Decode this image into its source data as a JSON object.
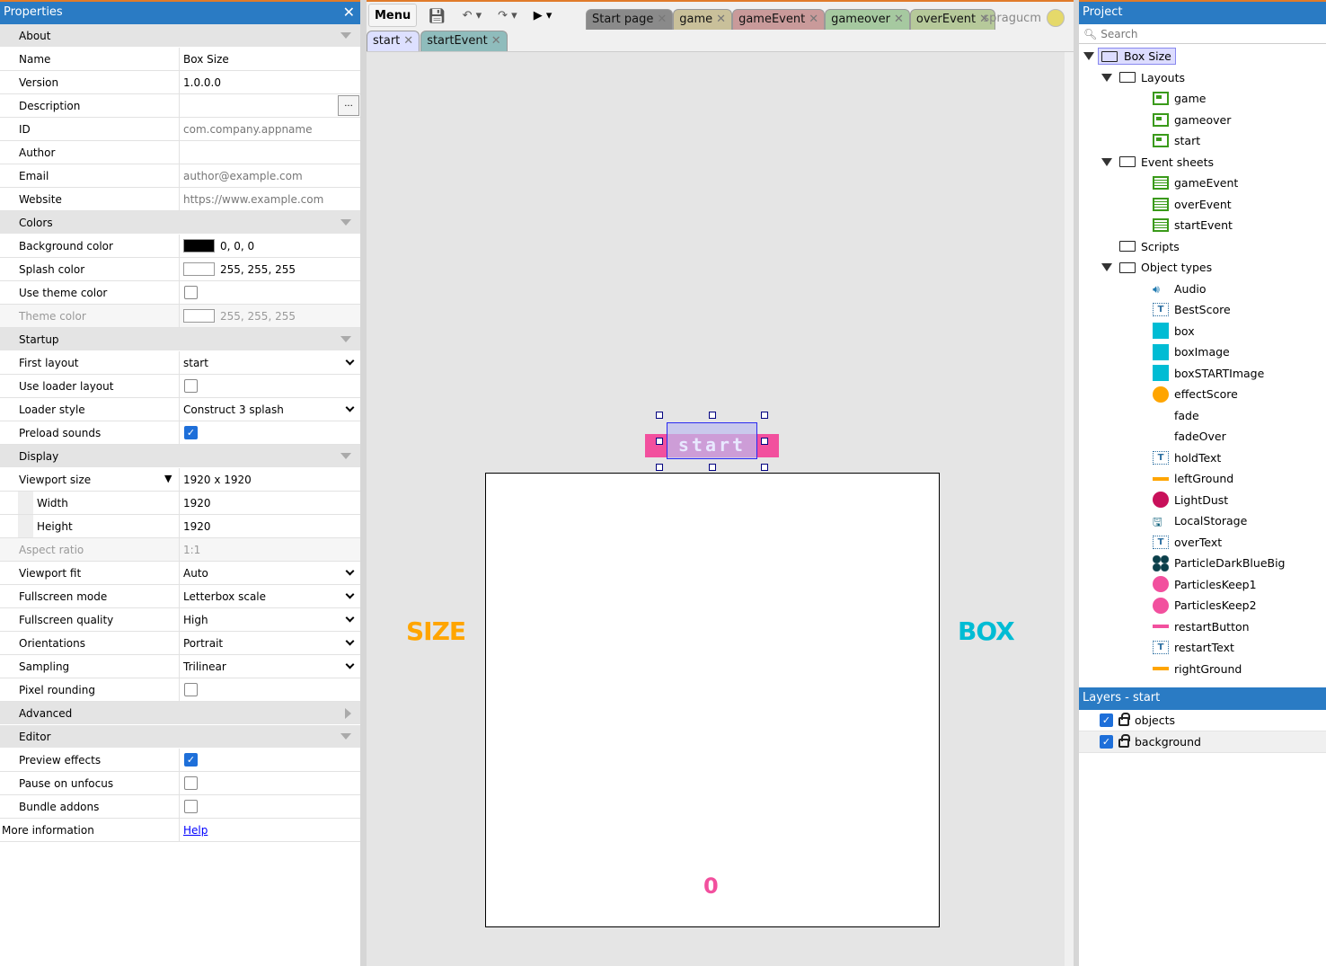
{
  "properties": {
    "title": "Properties",
    "rows": [
      {
        "t": "sec",
        "label": "About"
      },
      {
        "label": "Name",
        "value": "Box Size"
      },
      {
        "label": "Version",
        "value": "1.0.0.0"
      },
      {
        "label": "Description",
        "value": "",
        "button": "..."
      },
      {
        "label": "ID",
        "value": "com.company.appname",
        "grey": true
      },
      {
        "label": "Author",
        "value": ""
      },
      {
        "label": "Email",
        "value": "author@example.com",
        "grey": true
      },
      {
        "label": "Website",
        "value": "https://www.example.com",
        "grey": true
      },
      {
        "t": "sec",
        "label": "Colors"
      },
      {
        "label": "Background color",
        "value": "0, 0, 0",
        "swatch": "#000000"
      },
      {
        "label": "Splash color",
        "value": "255, 255, 255",
        "swatch": "#ffffff"
      },
      {
        "label": "Use theme color",
        "check": false
      },
      {
        "label": "Theme color",
        "value": "255, 255, 255",
        "swatch": "#ffffff",
        "disabled": true
      },
      {
        "t": "sec",
        "label": "Startup"
      },
      {
        "label": "First layout",
        "value": "start",
        "select": true
      },
      {
        "label": "Use loader layout",
        "check": false
      },
      {
        "label": "Loader style",
        "value": "Construct 3 splash",
        "select": true
      },
      {
        "label": "Preload sounds",
        "check": true
      },
      {
        "t": "sec",
        "label": "Display"
      },
      {
        "label": "Viewport size",
        "value": "1920 x 1920",
        "expand": true
      },
      {
        "label": "Width",
        "value": "1920",
        "sub": true
      },
      {
        "label": "Height",
        "value": "1920",
        "sub": true
      },
      {
        "label": "Aspect ratio",
        "value": "1:1",
        "disabled": true
      },
      {
        "label": "Viewport fit",
        "value": "Auto",
        "select": true
      },
      {
        "label": "Fullscreen mode",
        "value": "Letterbox scale",
        "select": true
      },
      {
        "label": "Fullscreen quality",
        "value": "High",
        "select": true
      },
      {
        "label": "Orientations",
        "value": "Portrait",
        "select": true
      },
      {
        "label": "Sampling",
        "value": "Trilinear",
        "select": true
      },
      {
        "label": "Pixel rounding",
        "check": false
      },
      {
        "t": "sec",
        "label": "Advanced",
        "collapsed": true
      },
      {
        "t": "sec",
        "label": "Editor"
      },
      {
        "label": "Preview effects",
        "check": true
      },
      {
        "label": "Pause on unfocus",
        "check": false
      },
      {
        "label": "Bundle addons",
        "check": false
      },
      {
        "label": "More information",
        "link": "Help",
        "top": true
      }
    ]
  },
  "toolbar": {
    "menu": "Menu",
    "user": "spragucm"
  },
  "tabs": [
    {
      "label": "Start page",
      "color": "#8a8a8a"
    },
    {
      "label": "game",
      "color": "#c9c09a"
    },
    {
      "label": "gameEvent",
      "color": "#c99a9a"
    },
    {
      "label": "gameover",
      "color": "#a6c9a0"
    },
    {
      "label": "overEvent",
      "color": "#b6c99a"
    }
  ],
  "subtabs": [
    {
      "label": "start",
      "color": "#dde0ff"
    },
    {
      "label": "startEvent",
      "color": "#8fbcbc"
    }
  ],
  "canvas": {
    "size_text": "SIZE",
    "box_text": "BOX",
    "score": "0",
    "start_label": "start"
  },
  "project": {
    "title": "Project",
    "search_placeholder": "Search",
    "items": [
      {
        "label": "Box Size",
        "level": 0,
        "icon": "folder",
        "open": true,
        "sel": true
      },
      {
        "label": "Layouts",
        "level": 1,
        "icon": "folder",
        "open": true
      },
      {
        "label": "game",
        "level": 2,
        "icon": "layout"
      },
      {
        "label": "gameover",
        "level": 2,
        "icon": "layout"
      },
      {
        "label": "start",
        "level": 2,
        "icon": "layout"
      },
      {
        "label": "Event sheets",
        "level": 1,
        "icon": "folder",
        "open": true
      },
      {
        "label": "gameEvent",
        "level": 2,
        "icon": "event"
      },
      {
        "label": "overEvent",
        "level": 2,
        "icon": "event"
      },
      {
        "label": "startEvent",
        "level": 2,
        "icon": "event"
      },
      {
        "label": "Scripts",
        "level": 1,
        "icon": "folder"
      },
      {
        "label": "Object types",
        "level": 1,
        "icon": "folder",
        "open": true
      },
      {
        "label": "Audio",
        "level": 2,
        "icon": "audio"
      },
      {
        "label": "BestScore",
        "level": 2,
        "icon": "text"
      },
      {
        "label": "box",
        "level": 2,
        "icon": "sq"
      },
      {
        "label": "boxImage",
        "level": 2,
        "icon": "sq"
      },
      {
        "label": "boxSTARTImage",
        "level": 2,
        "icon": "sq"
      },
      {
        "label": "effectScore",
        "level": 2,
        "icon": "circ",
        "color": "#ffa500"
      },
      {
        "label": "fade",
        "level": 2,
        "icon": "none"
      },
      {
        "label": "fadeOver",
        "level": 2,
        "icon": "none"
      },
      {
        "label": "holdText",
        "level": 2,
        "icon": "text"
      },
      {
        "label": "leftGround",
        "level": 2,
        "icon": "line",
        "color": "#ffa500"
      },
      {
        "label": "LightDust",
        "level": 2,
        "icon": "circ",
        "color": "#c8105a"
      },
      {
        "label": "LocalStorage",
        "level": 2,
        "icon": "storage"
      },
      {
        "label": "overText",
        "level": 2,
        "icon": "text"
      },
      {
        "label": "ParticleDarkBlueBig",
        "level": 2,
        "icon": "particles"
      },
      {
        "label": "ParticlesKeep1",
        "level": 2,
        "icon": "circ",
        "color": "#f2509e"
      },
      {
        "label": "ParticlesKeep2",
        "level": 2,
        "icon": "circ",
        "color": "#f2509e"
      },
      {
        "label": "restartButton",
        "level": 2,
        "icon": "line",
        "color": "#f2509e"
      },
      {
        "label": "restartText",
        "level": 2,
        "icon": "text"
      },
      {
        "label": "rightGround",
        "level": 2,
        "icon": "line",
        "color": "#ffa500"
      }
    ]
  },
  "layers": {
    "title": "Layers - start",
    "items": [
      {
        "label": "objects",
        "visible": true
      },
      {
        "label": "background",
        "visible": true
      }
    ]
  }
}
